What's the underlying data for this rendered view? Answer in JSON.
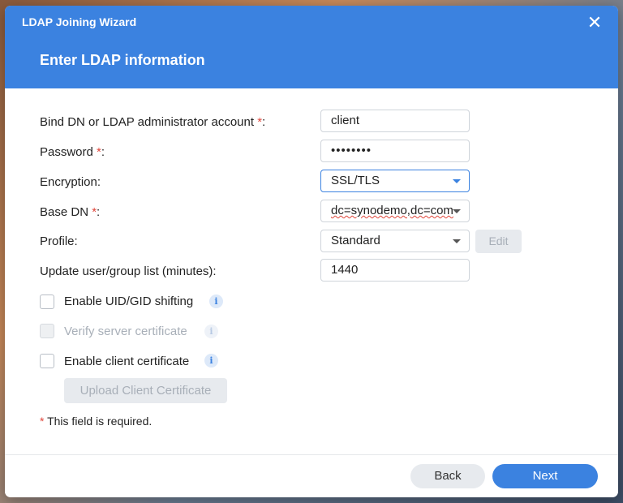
{
  "window": {
    "title": "LDAP Joining Wizard",
    "close_icon": "close-icon",
    "step_title": "Enter LDAP information"
  },
  "form": {
    "bind_dn": {
      "label": "Bind DN or LDAP administrator account",
      "required": "*",
      "suffix": ":",
      "value": "client"
    },
    "password": {
      "label": "Password",
      "required": "*",
      "suffix": ":",
      "value": "••••••••"
    },
    "encryption": {
      "label": "Encryption:",
      "value": "SSL/TLS"
    },
    "base_dn": {
      "label": "Base DN",
      "required": "*",
      "suffix": ":",
      "value": "dc=synodemo,dc=com"
    },
    "profile": {
      "label": "Profile:",
      "value": "Standard",
      "edit_label": "Edit"
    },
    "update_interval": {
      "label": "Update user/group list (minutes):",
      "value": "1440"
    }
  },
  "options": {
    "uid_shift": {
      "label": "Enable UID/GID shifting",
      "checked": false,
      "disabled": false
    },
    "verify_cert": {
      "label": "Verify server certificate",
      "checked": false,
      "disabled": true
    },
    "client_cert": {
      "label": "Enable client certificate",
      "checked": false,
      "disabled": false
    },
    "info_glyph": "i",
    "upload_label": "Upload Client Certificate"
  },
  "note": {
    "asterisk": "*",
    "text": " This field is required."
  },
  "footer": {
    "back_label": "Back",
    "next_label": "Next"
  },
  "colors": {
    "accent": "#3b82e0",
    "required": "#e0463b"
  }
}
